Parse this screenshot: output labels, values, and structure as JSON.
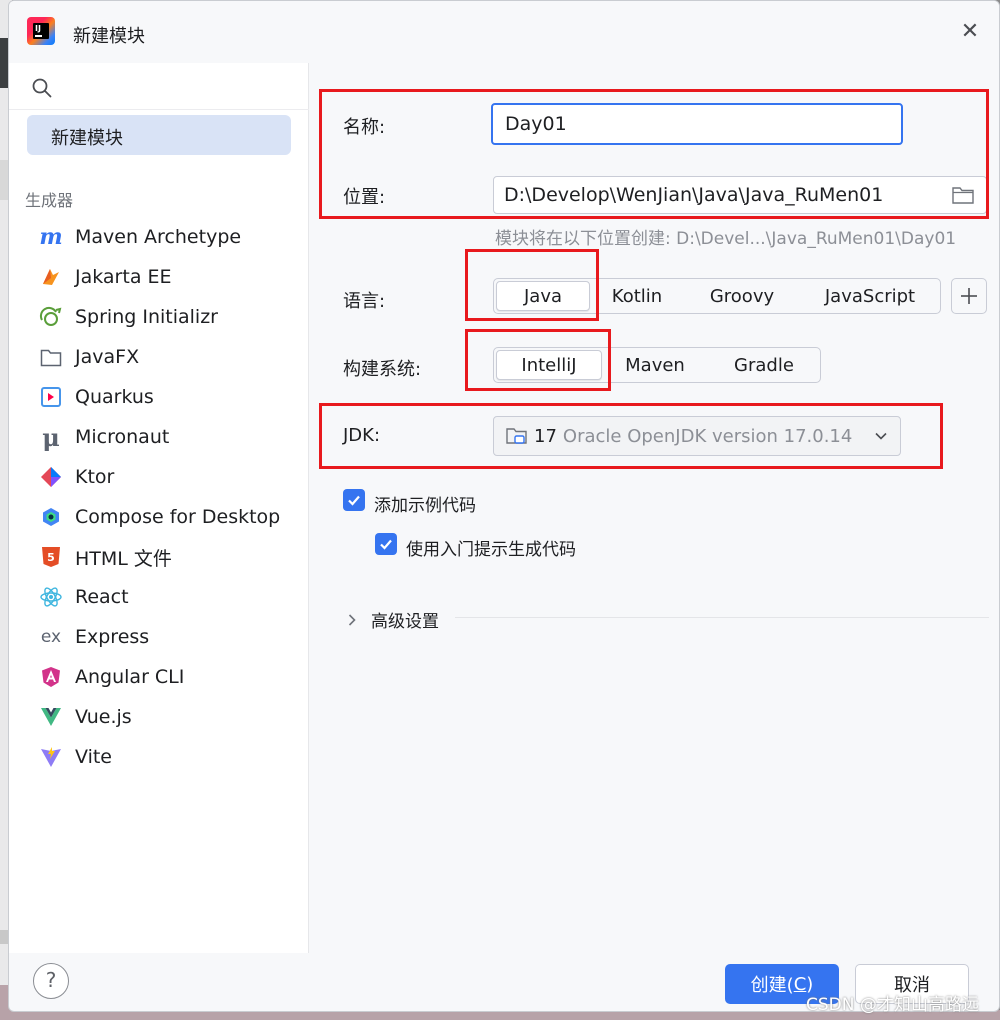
{
  "dialog": {
    "title": "新建模块",
    "close_glyph": "✕"
  },
  "sidebar": {
    "selected_item": "新建模块",
    "generators_label": "生成器",
    "generators": [
      {
        "label": "Maven Archetype",
        "icon": "maven-icon"
      },
      {
        "label": "Jakarta EE",
        "icon": "jakarta-ee-icon"
      },
      {
        "label": "Spring Initializr",
        "icon": "spring-icon"
      },
      {
        "label": "JavaFX",
        "icon": "javafx-folder-icon"
      },
      {
        "label": "Quarkus",
        "icon": "quarkus-icon"
      },
      {
        "label": "Micronaut",
        "icon": "micronaut-icon"
      },
      {
        "label": "Ktor",
        "icon": "ktor-icon"
      },
      {
        "label": "Compose for Desktop",
        "icon": "compose-icon"
      },
      {
        "label": "HTML 文件",
        "icon": "html5-icon"
      },
      {
        "label": "React",
        "icon": "react-icon"
      },
      {
        "label": "Express",
        "icon": "express-icon"
      },
      {
        "label": "Angular CLI",
        "icon": "angular-icon"
      },
      {
        "label": "Vue.js",
        "icon": "vue-icon"
      },
      {
        "label": "Vite",
        "icon": "vite-icon"
      }
    ]
  },
  "form": {
    "name_label": "名称:",
    "name_value": "Day01",
    "location_label": "位置:",
    "location_value": "D:\\Develop\\WenJian\\Java\\Java_RuMen01",
    "location_hint": "模块将在以下位置创建: D:\\Devel...\\Java_RuMen01\\Day01",
    "language_label": "语言:",
    "languages": [
      "Java",
      "Kotlin",
      "Groovy",
      "JavaScript"
    ],
    "selected_language": "Java",
    "build_label": "构建系统:",
    "build_systems": [
      "IntelliJ",
      "Maven",
      "Gradle"
    ],
    "selected_build": "IntelliJ",
    "jdk_label": "JDK:",
    "jdk_version": "17",
    "jdk_description": "Oracle OpenJDK version 17.0.14",
    "add_sample_code_label": "添加示例代码",
    "add_sample_code_checked": true,
    "onboarding_tips_label": "使用入门提示生成代码",
    "onboarding_tips_checked": true,
    "advanced_label": "高级设置"
  },
  "footer": {
    "help_glyph": "?",
    "create_label": "创建(",
    "create_mnemonic": "C",
    "create_label_end": ")",
    "cancel_label": "取消"
  },
  "watermark": "CSDN @才知山高路远",
  "colors": {
    "accent": "#3574f0",
    "annotation_red": "#e8191d",
    "selected_bg": "#d9e3f6"
  }
}
